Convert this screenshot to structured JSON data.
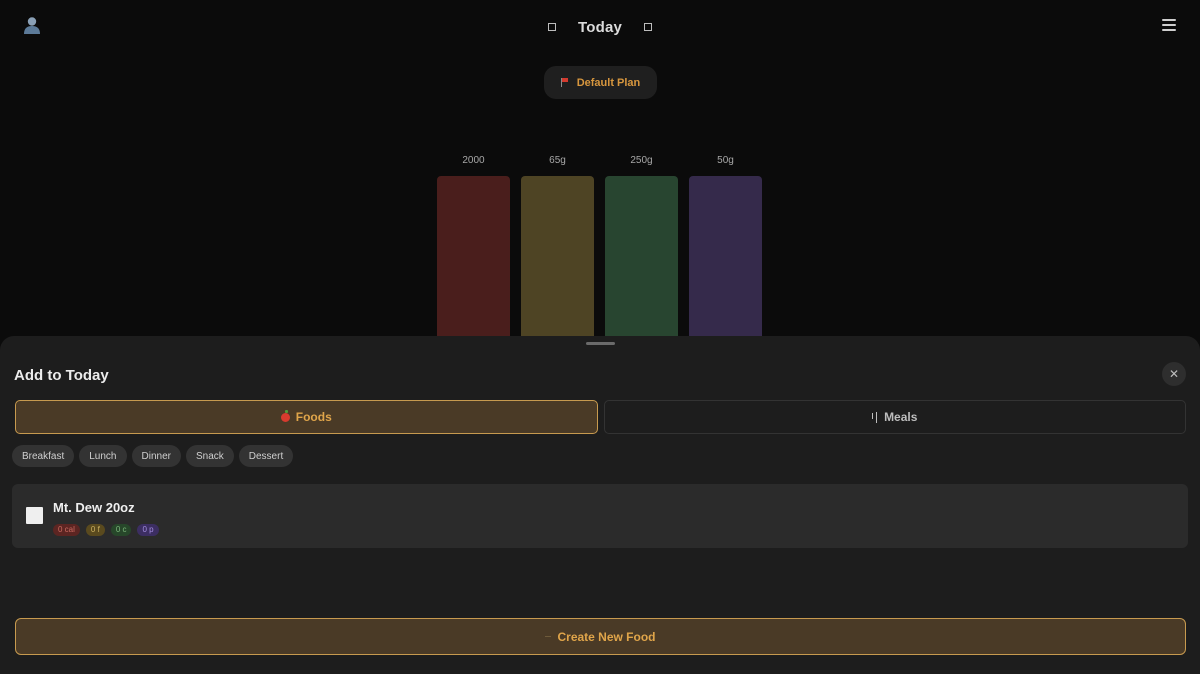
{
  "header": {
    "date_title": "Today",
    "prev_icon": "square-outline-icon",
    "next_icon": "square-outline-icon",
    "avatar_icon": "user-silhouette-icon",
    "menu_icon": "hamburger-menu-icon"
  },
  "plan": {
    "label": "Default Plan",
    "icon": "red-flag-icon"
  },
  "targets": [
    {
      "label": "2000",
      "color": "#4a1e1c"
    },
    {
      "label": "65g",
      "color": "#4e4424"
    },
    {
      "label": "250g",
      "color": "#284530"
    },
    {
      "label": "50g",
      "color": "#352a4b"
    }
  ],
  "sheet": {
    "title": "Add to Today",
    "close_icon": "close-x-icon",
    "tabs": [
      {
        "label": "Foods",
        "icon": "apple-icon",
        "active": true
      },
      {
        "label": "Meals",
        "icon": "utensils-icon",
        "active": false
      }
    ],
    "meal_filters": [
      "Breakfast",
      "Lunch",
      "Dinner",
      "Snack",
      "Dessert"
    ],
    "food_items": [
      {
        "name": "Mt. Dew 20oz",
        "macros": {
          "calories": "0 cal",
          "fat": "0 f",
          "carbs": "0 c",
          "protein": "0 p"
        }
      }
    ],
    "create_button": {
      "label": "Create New Food",
      "icon": "plus-icon"
    }
  },
  "colors": {
    "accent": "#e0a54a",
    "accent_border": "#c79a4f",
    "accent_fill": "#4a3a26",
    "page_bg": "#0b0b0b",
    "sheet_bg": "#1d1d1d"
  }
}
